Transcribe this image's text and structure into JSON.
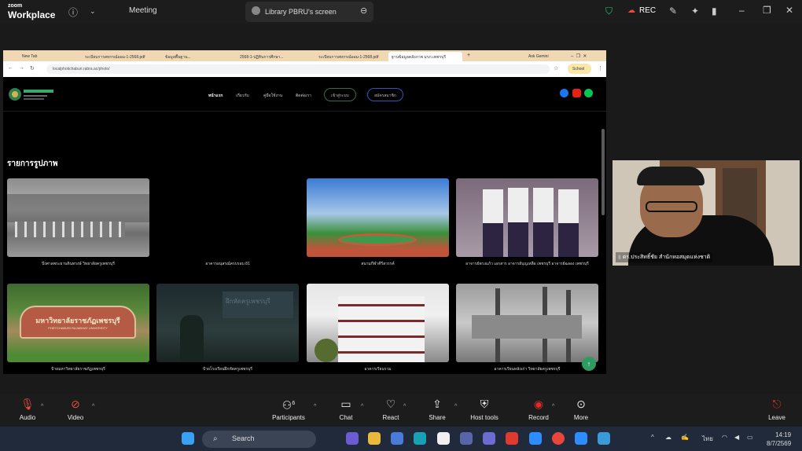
{
  "zoom": {
    "brand_small": "zoom",
    "brand": "Workplace",
    "meeting_label": "Meeting",
    "screen_tab_label": "Library PBRU's screen",
    "rec_label": "REC"
  },
  "browser": {
    "tabs": [
      "New Tab",
      "ระเบียบการสหกรณ์ออม-1-2568.pdf",
      "ข้อมูลพื้นฐาน...",
      "2568-1-ปฏิทินการศึกษา...",
      "ระเบียบการสหกรณ์ออม-1-2568.pdf",
      "ฐานข้อมูลคลังภาพ มรภ.เพชรบุรี"
    ],
    "new_tab": "+",
    "ask_gemini": "Ask Gemini",
    "url": "localphotichaburi.rabra.ac/photo/",
    "school": "School"
  },
  "site": {
    "nav": [
      "หน้าแรก",
      "เกี่ยวกับ",
      "คู่มือใช้งาน",
      "ติดต่อเรา"
    ],
    "btn_login": "เข้าสู่ระบบ",
    "btn_register": "สมัครสมาชิก",
    "section_title": "รายการรูปภาพ",
    "cards": [
      {
        "caption": "บึงศาลพระยาบดินทรงษ์ วิทยาลัยครูเพชรบุรี"
      },
      {
        "caption": "อาคารอนุสรณ์ครบรอบ 81"
      },
      {
        "caption": "สนามกีฬาคีรีสวรรค์"
      },
      {
        "caption": "อาจารย์พวงแก้ว เอกสาร อาจารย์บุญเหลือ เพชรบุรี อาจารย์ฉลอง เพชรบุรี"
      },
      {
        "caption": "ป้ายมหาวิทยาลัยราชภัฏเพชรบุรี"
      },
      {
        "caption": "ป้ายโรงเรียนฝึกหัดครูเพชรบุรี"
      },
      {
        "caption": "อาคารเรียนรวม"
      },
      {
        "caption": "อาคารเรียนหลังเก่า วิทยาลัยครูเพชรบุรี"
      }
    ],
    "sign_text": "มหาวิทยาลัยราชภัฏเพชรบุรี",
    "sign_sub": "PHETCHABURI RAJABHAT UNIVERSITY"
  },
  "participant": {
    "name": "ดร.ประสิทธิ์ชัย สำนักหอสมุดแห่งชาติ"
  },
  "toolbar": {
    "audio": "Audio",
    "video": "Video",
    "participants": "Participants",
    "participants_count": "6",
    "chat": "Chat",
    "react": "React",
    "share": "Share",
    "host_tools": "Host tools",
    "record": "Record",
    "more": "More",
    "leave": "Leave"
  },
  "taskbar": {
    "search": "Search",
    "time": "14:19",
    "date": "8/7/2569",
    "lang": "ไทย"
  },
  "colors": {
    "zoom_bg": "#1c1c1c",
    "record_red": "#e02b2b",
    "site_green": "#2e9b63",
    "taskbar": "#202a3a"
  }
}
